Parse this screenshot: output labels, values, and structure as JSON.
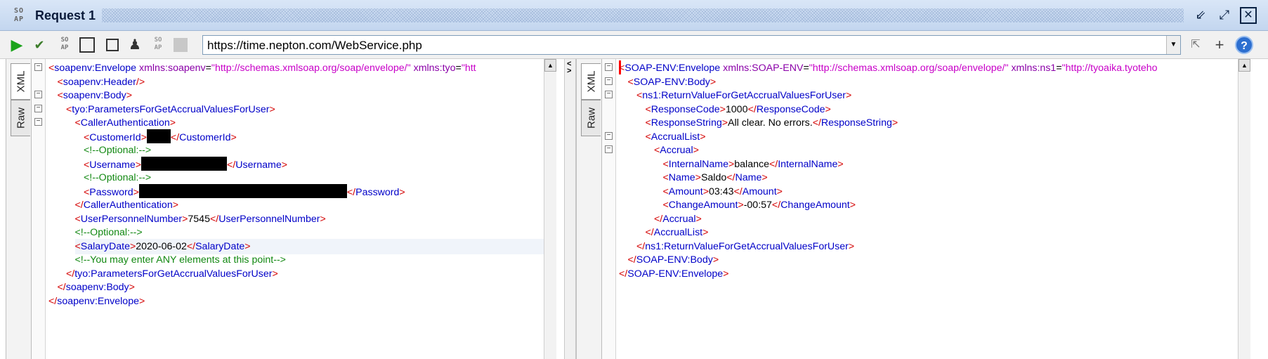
{
  "window": {
    "logo": "SO AP",
    "title": "Request 1",
    "min_glyph": "⇙",
    "max_glyph": "⤢",
    "close_glyph": "✕"
  },
  "toolbar": {
    "url": "https://time.nepton.com/WebService.php",
    "dropdown_glyph": "▼",
    "help_glyph": "?",
    "add_glyph": "+"
  },
  "tabs": {
    "xml": "XML",
    "raw": "Raw"
  },
  "request": {
    "lines": [
      {
        "indent": 0,
        "parts": [
          [
            "tg",
            "<"
          ],
          [
            "nm",
            "soapenv:Envelope"
          ],
          [
            "an",
            " xmlns:soapenv"
          ],
          [
            "tx",
            "="
          ],
          [
            "av",
            "\"http://schemas.xmlsoap.org/soap/envelope/\""
          ],
          [
            "an",
            " xmlns:tyo"
          ],
          [
            "tx",
            "="
          ],
          [
            "av",
            "\"htt"
          ]
        ]
      },
      {
        "indent": 1,
        "parts": [
          [
            "tg",
            "<"
          ],
          [
            "nm",
            "soapenv:Header"
          ],
          [
            "tg",
            "/>"
          ]
        ]
      },
      {
        "indent": 1,
        "parts": [
          [
            "tg",
            "<"
          ],
          [
            "nm",
            "soapenv:Body"
          ],
          [
            "tg",
            ">"
          ]
        ]
      },
      {
        "indent": 2,
        "parts": [
          [
            "tg",
            "<"
          ],
          [
            "nm",
            "tyo:ParametersForGetAccrualValuesForUser"
          ],
          [
            "tg",
            ">"
          ]
        ]
      },
      {
        "indent": 3,
        "parts": [
          [
            "tg",
            "<"
          ],
          [
            "nm",
            "CallerAuthentication"
          ],
          [
            "tg",
            ">"
          ]
        ]
      },
      {
        "indent": 4,
        "parts": [
          [
            "tg",
            "<"
          ],
          [
            "nm",
            "CustomerId"
          ],
          [
            "tg",
            ">"
          ],
          [
            "rd",
            "34"
          ],
          [
            "tg",
            "</"
          ],
          [
            "nm",
            "CustomerId"
          ],
          [
            "tg",
            ">"
          ]
        ]
      },
      {
        "indent": 4,
        "parts": [
          [
            "cm",
            "<!--Optional:-->"
          ]
        ]
      },
      {
        "indent": 4,
        "parts": [
          [
            "tg",
            "<"
          ],
          [
            "nm",
            "Username"
          ],
          [
            "tg",
            ">"
          ],
          [
            "rd",
            "122"
          ],
          [
            "tg",
            "</"
          ],
          [
            "nm",
            "Username"
          ],
          [
            "tg",
            ">"
          ]
        ]
      },
      {
        "indent": 4,
        "parts": [
          [
            "cm",
            "<!--Optional:-->"
          ]
        ]
      },
      {
        "indent": 4,
        "parts": [
          [
            "tg",
            "<"
          ],
          [
            "nm",
            "Password"
          ],
          [
            "tg",
            ">"
          ],
          [
            "rd",
            "296"
          ],
          [
            "tg",
            "</"
          ],
          [
            "nm",
            "Password"
          ],
          [
            "tg",
            ">"
          ]
        ]
      },
      {
        "indent": 3,
        "parts": [
          [
            "tg",
            "</"
          ],
          [
            "nm",
            "CallerAuthentication"
          ],
          [
            "tg",
            ">"
          ]
        ]
      },
      {
        "indent": 3,
        "parts": [
          [
            "tg",
            "<"
          ],
          [
            "nm",
            "UserPersonnelNumber"
          ],
          [
            "tg",
            ">"
          ],
          [
            "tx",
            "7545"
          ],
          [
            "tg",
            "</"
          ],
          [
            "nm",
            "UserPersonnelNumber"
          ],
          [
            "tg",
            ">"
          ]
        ]
      },
      {
        "indent": 3,
        "parts": [
          [
            "cm",
            "<!--Optional:-->"
          ]
        ]
      },
      {
        "indent": 3,
        "hl": true,
        "parts": [
          [
            "tg",
            "<"
          ],
          [
            "nm",
            "SalaryDate"
          ],
          [
            "tg",
            ">"
          ],
          [
            "tx",
            "2020-06-02"
          ],
          [
            "tg",
            "</"
          ],
          [
            "nm",
            "SalaryDate"
          ],
          [
            "tg",
            ">"
          ]
        ]
      },
      {
        "indent": 3,
        "parts": [
          [
            "cm",
            "<!--You may enter ANY elements at this point-->"
          ]
        ]
      },
      {
        "indent": 2,
        "parts": [
          [
            "tg",
            "</"
          ],
          [
            "nm",
            "tyo:ParametersForGetAccrualValuesForUser"
          ],
          [
            "tg",
            ">"
          ]
        ]
      },
      {
        "indent": 1,
        "parts": [
          [
            "tg",
            "</"
          ],
          [
            "nm",
            "soapenv:Body"
          ],
          [
            "tg",
            ">"
          ]
        ]
      },
      {
        "indent": 0,
        "parts": [
          [
            "tg",
            "</"
          ],
          [
            "nm",
            "soapenv:Envelope"
          ],
          [
            "tg",
            ">"
          ]
        ]
      }
    ],
    "folds": [
      0,
      2,
      3,
      4
    ]
  },
  "response": {
    "lines": [
      {
        "indent": 0,
        "parts": [
          [
            "tg",
            "<"
          ],
          [
            "nm",
            "SOAP-ENV:Envelope"
          ],
          [
            "an",
            " xmlns:SOAP-ENV"
          ],
          [
            "tx",
            "="
          ],
          [
            "av",
            "\"http://schemas.xmlsoap.org/soap/envelope/\""
          ],
          [
            "an",
            " xmlns:ns1"
          ],
          [
            "tx",
            "="
          ],
          [
            "av",
            "\"http://tyoaika.tyoteho"
          ]
        ]
      },
      {
        "indent": 1,
        "parts": [
          [
            "tg",
            "<"
          ],
          [
            "nm",
            "SOAP-ENV:Body"
          ],
          [
            "tg",
            ">"
          ]
        ]
      },
      {
        "indent": 2,
        "parts": [
          [
            "tg",
            "<"
          ],
          [
            "nm",
            "ns1:ReturnValueForGetAccrualValuesForUser"
          ],
          [
            "tg",
            ">"
          ]
        ]
      },
      {
        "indent": 3,
        "parts": [
          [
            "tg",
            "<"
          ],
          [
            "nm",
            "ResponseCode"
          ],
          [
            "tg",
            ">"
          ],
          [
            "tx",
            "1000"
          ],
          [
            "tg",
            "</"
          ],
          [
            "nm",
            "ResponseCode"
          ],
          [
            "tg",
            ">"
          ]
        ]
      },
      {
        "indent": 3,
        "parts": [
          [
            "tg",
            "<"
          ],
          [
            "nm",
            "ResponseString"
          ],
          [
            "tg",
            ">"
          ],
          [
            "tx",
            "All clear. No errors."
          ],
          [
            "tg",
            "</"
          ],
          [
            "nm",
            "ResponseString"
          ],
          [
            "tg",
            ">"
          ]
        ]
      },
      {
        "indent": 3,
        "parts": [
          [
            "tg",
            "<"
          ],
          [
            "nm",
            "AccrualList"
          ],
          [
            "tg",
            ">"
          ]
        ]
      },
      {
        "indent": 4,
        "parts": [
          [
            "tg",
            "<"
          ],
          [
            "nm",
            "Accrual"
          ],
          [
            "tg",
            ">"
          ]
        ]
      },
      {
        "indent": 5,
        "parts": [
          [
            "tg",
            "<"
          ],
          [
            "nm",
            "InternalName"
          ],
          [
            "tg",
            ">"
          ],
          [
            "tx",
            "balance"
          ],
          [
            "tg",
            "</"
          ],
          [
            "nm",
            "InternalName"
          ],
          [
            "tg",
            ">"
          ]
        ]
      },
      {
        "indent": 5,
        "parts": [
          [
            "tg",
            "<"
          ],
          [
            "nm",
            "Name"
          ],
          [
            "tg",
            ">"
          ],
          [
            "tx",
            "Saldo"
          ],
          [
            "tg",
            "</"
          ],
          [
            "nm",
            "Name"
          ],
          [
            "tg",
            ">"
          ]
        ]
      },
      {
        "indent": 5,
        "parts": [
          [
            "tg",
            "<"
          ],
          [
            "nm",
            "Amount"
          ],
          [
            "tg",
            ">"
          ],
          [
            "tx",
            "03:43"
          ],
          [
            "tg",
            "</"
          ],
          [
            "nm",
            "Amount"
          ],
          [
            "tg",
            ">"
          ]
        ]
      },
      {
        "indent": 5,
        "parts": [
          [
            "tg",
            "<"
          ],
          [
            "nm",
            "ChangeAmount"
          ],
          [
            "tg",
            ">"
          ],
          [
            "tx",
            "-00:57"
          ],
          [
            "tg",
            "</"
          ],
          [
            "nm",
            "ChangeAmount"
          ],
          [
            "tg",
            ">"
          ]
        ]
      },
      {
        "indent": 4,
        "parts": [
          [
            "tg",
            "</"
          ],
          [
            "nm",
            "Accrual"
          ],
          [
            "tg",
            ">"
          ]
        ]
      },
      {
        "indent": 3,
        "parts": [
          [
            "tg",
            "</"
          ],
          [
            "nm",
            "AccrualList"
          ],
          [
            "tg",
            ">"
          ]
        ]
      },
      {
        "indent": 2,
        "parts": [
          [
            "tg",
            "</"
          ],
          [
            "nm",
            "ns1:ReturnValueForGetAccrualValuesForUser"
          ],
          [
            "tg",
            ">"
          ]
        ]
      },
      {
        "indent": 1,
        "parts": [
          [
            "tg",
            "</"
          ],
          [
            "nm",
            "SOAP-ENV:Body"
          ],
          [
            "tg",
            ">"
          ]
        ]
      },
      {
        "indent": 0,
        "parts": [
          [
            "tg",
            "</"
          ],
          [
            "nm",
            "SOAP-ENV:Envelope"
          ],
          [
            "tg",
            ">"
          ]
        ]
      }
    ],
    "folds": [
      0,
      1,
      2,
      5,
      6
    ]
  },
  "colors": {
    "tag_bracket": "#d40000",
    "element_name": "#0000c8",
    "attribute_name": "#8a00a8",
    "attribute_value": "#c800c8",
    "comment": "#118811",
    "play_button": "#1aa31a"
  },
  "icons": {
    "toolbar": [
      "play-icon",
      "check-icon",
      "soap-icon",
      "frame-icon",
      "square-icon",
      "user-icon",
      "soap-disabled-icon",
      "disabled-icon"
    ],
    "right": [
      "reset-icon",
      "add-icon",
      "help-icon"
    ]
  }
}
